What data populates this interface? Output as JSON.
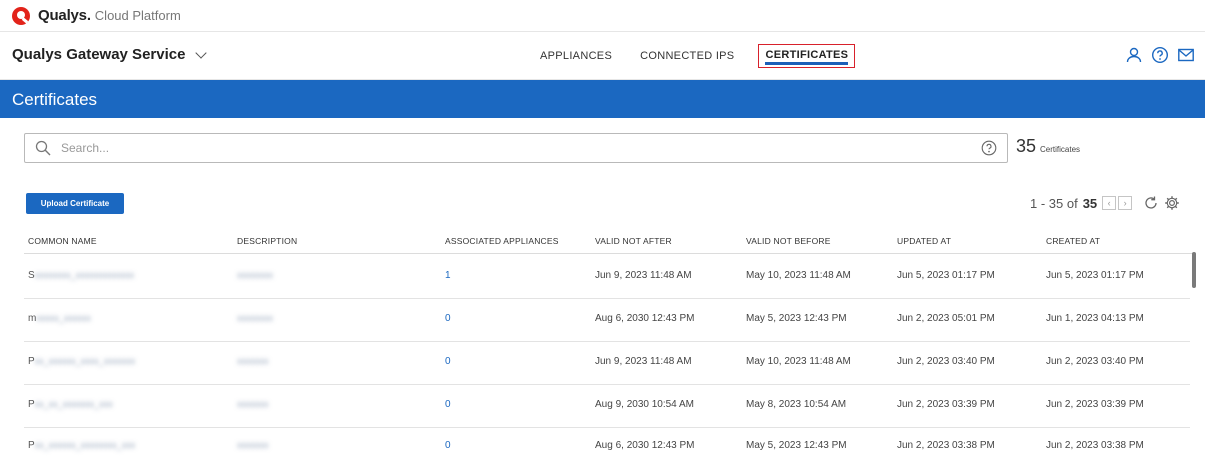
{
  "brand": {
    "name": "Qualys.",
    "sub": "Cloud Platform"
  },
  "app": {
    "title": "Qualys Gateway Service"
  },
  "nav": {
    "items": [
      {
        "label": "APPLIANCES"
      },
      {
        "label": "CONNECTED IPS"
      },
      {
        "label": "CERTIFICATES",
        "active": true
      }
    ]
  },
  "banner": {
    "title": "Certificates"
  },
  "search": {
    "placeholder": "Search...",
    "value": ""
  },
  "count": {
    "number": "35",
    "label": "Certificates"
  },
  "toolbar": {
    "upload_label": "Upload Certificate"
  },
  "pager": {
    "range": "1 - 35 of",
    "total": "35"
  },
  "table": {
    "columns": [
      "COMMON NAME",
      "DESCRIPTION",
      "ASSOCIATED APPLIANCES",
      "VALID NOT AFTER",
      "VALID NOT BEFORE",
      "UPDATED AT",
      "CREATED AT"
    ],
    "rows": [
      {
        "common_first": "S",
        "common_rest": "xxxxxxxx_xxxxxxxxxxxxx",
        "description": "xxxxxxxx",
        "appliances": "1",
        "valid_after": "Jun 9, 2023 11:48 AM",
        "valid_before": "May 10, 2023 11:48 AM",
        "updated": "Jun 5, 2023 01:17 PM",
        "created": "Jun 5, 2023 01:17 PM"
      },
      {
        "common_first": "m",
        "common_rest": "xxxxx_xxxxxx",
        "description": "xxxxxxxx",
        "appliances": "0",
        "valid_after": "Aug 6, 2030 12:43 PM",
        "valid_before": "May 5, 2023 12:43 PM",
        "updated": "Jun 2, 2023 05:01 PM",
        "created": "Jun 1, 2023 04:13 PM"
      },
      {
        "common_first": "P",
        "common_rest": "xx_xxxxxx_xxxx_xxxxxxx",
        "description": "xxxxxxx",
        "appliances": "0",
        "valid_after": "Jun 9, 2023 11:48 AM",
        "valid_before": "May 10, 2023 11:48 AM",
        "updated": "Jun 2, 2023 03:40 PM",
        "created": "Jun 2, 2023 03:40 PM"
      },
      {
        "common_first": "P",
        "common_rest": "xx_xx_xxxxxxx_xxx",
        "description": "xxxxxxx",
        "appliances": "0",
        "valid_after": "Aug 9, 2030 10:54 AM",
        "valid_before": "May 8, 2023 10:54 AM",
        "updated": "Jun 2, 2023 03:39 PM",
        "created": "Jun 2, 2023 03:39 PM"
      },
      {
        "common_first": "P",
        "common_rest": "xx_xxxxxx_xxxxxxxx_xxx",
        "description": "xxxxxxx",
        "appliances": "0",
        "valid_after": "Aug 6, 2030 12:43 PM",
        "valid_before": "May 5, 2023 12:43 PM",
        "updated": "Jun 2, 2023 03:38 PM",
        "created": "Jun 2, 2023 03:38 PM"
      }
    ]
  },
  "colors": {
    "brand_blue": "#1b68c1",
    "brand_red": "#e2231a",
    "active_border": "#d8212b"
  },
  "icons": {
    "user": "user-icon",
    "help": "help-circle-icon",
    "mail": "mail-icon",
    "search": "search-icon",
    "refresh": "refresh-icon",
    "settings": "gear-icon"
  }
}
